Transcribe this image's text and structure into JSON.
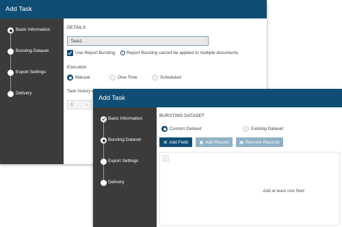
{
  "window1": {
    "title": "Add Task",
    "steps": [
      {
        "label": "Basic Information",
        "state": "active"
      },
      {
        "label": "Bursting Dataset",
        "state": "pending"
      },
      {
        "label": "Export Settings",
        "state": "pending"
      },
      {
        "label": "Delivery",
        "state": "pending"
      }
    ],
    "details_heading": "DETAILS",
    "task_name_value": "Task1",
    "use_report_bursting_label": "Use Report Bursting",
    "use_report_bursting_checked": true,
    "bursting_info": "Report Bursting cannot be applied to multiple documents",
    "execution_label": "Execution",
    "execution_options": [
      "Manual",
      "One-Time",
      "Scheduled"
    ],
    "execution_selected": "Manual",
    "task_history_label": "Task history ex",
    "task_history_value": "0"
  },
  "window2": {
    "title": "Add Task",
    "steps": [
      {
        "label": "Basic Information",
        "state": "done"
      },
      {
        "label": "Bursting Dataset",
        "state": "active"
      },
      {
        "label": "Export Settings",
        "state": "pending"
      },
      {
        "label": "Delivery",
        "state": "pending"
      }
    ],
    "section_heading": "BURSTING DATASET",
    "dataset_options": [
      "Custom Dataset",
      "Existing Dataset"
    ],
    "dataset_selected": "Custom Dataset",
    "buttons": {
      "add_field": "Add Field",
      "add_record": "Add Record",
      "remove_records": "Remove Records"
    },
    "empty_message": "Add at least one field"
  },
  "colors": {
    "titlebar": "#0f4d74",
    "sidebar": "#3b3b3b",
    "accent": "#0f4d74",
    "disabled_button": "#8fb2c7"
  }
}
